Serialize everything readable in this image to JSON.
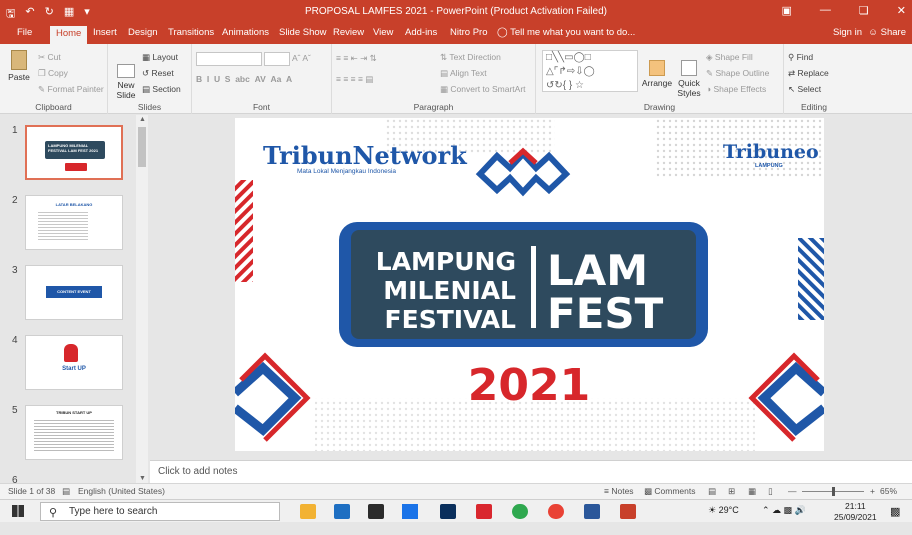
{
  "window": {
    "title": "PROPOSAL LAMFES 2021 - PowerPoint (Product Activation Failed)",
    "tell_me": "Tell me what you want to do...",
    "sign_in": "Sign in",
    "share": "Share"
  },
  "tabs": [
    "File",
    "Home",
    "Insert",
    "Design",
    "Transitions",
    "Animations",
    "Slide Show",
    "Review",
    "View",
    "Add-ins",
    "Nitro Pro"
  ],
  "active_tab": "Home",
  "ribbon": {
    "clipboard": {
      "label": "Clipboard",
      "paste": "Paste",
      "cut": "Cut",
      "copy": "Copy",
      "format_painter": "Format Painter"
    },
    "slides": {
      "label": "Slides",
      "new_slide": "New Slide",
      "layout": "Layout",
      "reset": "Reset",
      "section": "Section"
    },
    "font": {
      "label": "Font"
    },
    "paragraph": {
      "label": "Paragraph",
      "text_direction": "Text Direction",
      "align_text": "Align Text",
      "convert_smartart": "Convert to SmartArt"
    },
    "drawing": {
      "label": "Drawing",
      "arrange": "Arrange",
      "quick_styles": "Quick Styles",
      "shape_fill": "Shape Fill",
      "shape_outline": "Shape Outline",
      "shape_effects": "Shape Effects"
    },
    "editing": {
      "label": "Editing",
      "find": "Find",
      "replace": "Replace",
      "select": "Select"
    }
  },
  "thumbnails": [
    {
      "num": "1",
      "text": "LAMPUNG MILENIAL FESTIVAL LAM FEST 2021"
    },
    {
      "num": "2",
      "text": "LATAR BELAKANG"
    },
    {
      "num": "3",
      "text": "CONTENT EVENT"
    },
    {
      "num": "4",
      "text": "Start UP"
    },
    {
      "num": "5",
      "text": "TRIBUN START UP"
    },
    {
      "num": "6",
      "text": ""
    }
  ],
  "slide": {
    "logo_left": "TribunNetwork",
    "logo_left_tag": "Mata Lokal Menjangkau Indonesia",
    "logo_right": "Tribuneo",
    "logo_right_sub": "LAMPUNG",
    "banner_left_lines": [
      "LAMPUNG",
      "MILENIAL",
      "FESTIVAL"
    ],
    "banner_right_lines": [
      "LAM",
      "FEST"
    ],
    "year": "2021"
  },
  "notes_placeholder": "Click to add notes",
  "status": {
    "slide_info": "Slide 1 of 38",
    "language": "English (United States)",
    "notes": "Notes",
    "comments": "Comments",
    "zoom": "65%"
  },
  "taskbar": {
    "search_placeholder": "Type here to search",
    "weather": "29°C",
    "time": "21:11",
    "date": "25/09/2021"
  },
  "colors": {
    "accent": "#c8402a",
    "brand_blue": "#1f57a8",
    "banner_dark": "#2e4a5e",
    "brand_red": "#d7272b"
  }
}
